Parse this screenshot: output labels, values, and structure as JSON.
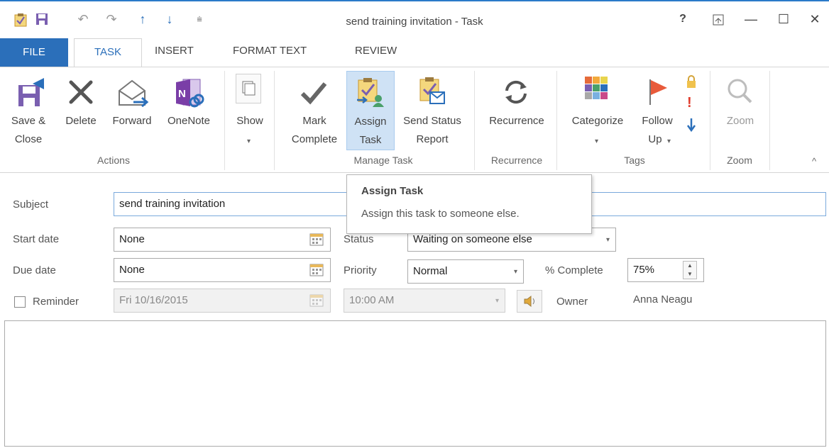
{
  "window": {
    "title": "send training invitation - Task",
    "help": "?",
    "minimize": "—",
    "maximize": "☐",
    "close": "✕"
  },
  "qat": {
    "undo": "↶",
    "redo": "↷",
    "up": "↑",
    "down": "↓",
    "more": "⩧"
  },
  "tabs": {
    "file": "FILE",
    "task": "TASK",
    "insert": "INSERT",
    "format_text": "FORMAT TEXT",
    "review": "REVIEW"
  },
  "ribbon": {
    "save_close": [
      "Save &",
      "Close"
    ],
    "delete": "Delete",
    "forward": "Forward",
    "onenote": "OneNote",
    "show": "Show",
    "mark_complete": [
      "Mark",
      "Complete"
    ],
    "assign_task": [
      "Assign",
      "Task"
    ],
    "send_status": [
      "Send Status",
      "Report"
    ],
    "recurrence": "Recurrence",
    "categorize": "Categorize",
    "follow_up": [
      "Follow",
      "Up"
    ],
    "zoom": "Zoom",
    "groups": {
      "actions": "Actions",
      "manage_task": "Manage Task",
      "recurrence": "Recurrence",
      "tags": "Tags",
      "zoom": "Zoom"
    },
    "collapse": "^"
  },
  "tooltip": {
    "title": "Assign Task",
    "description": "Assign this task to someone else."
  },
  "form": {
    "subject_label": "Subject",
    "subject_value": "send training invitation",
    "start_date_label": "Start date",
    "start_date_value": "None",
    "due_date_label": "Due date",
    "due_date_value": "None",
    "status_label": "Status",
    "status_value": "Waiting on someone else",
    "priority_label": "Priority",
    "priority_value": "Normal",
    "percent_label": "% Complete",
    "percent_value": "75%",
    "reminder_label": "Reminder",
    "reminder_checked": false,
    "reminder_date": "Fri 10/16/2015",
    "reminder_time": "10:00 AM",
    "owner_label": "Owner",
    "owner_value": "Anna Neagu"
  },
  "colors": {
    "file_tab": "#2b6fba",
    "accent": "#2b6fba",
    "tooltip_border": "#b5b5b5"
  }
}
